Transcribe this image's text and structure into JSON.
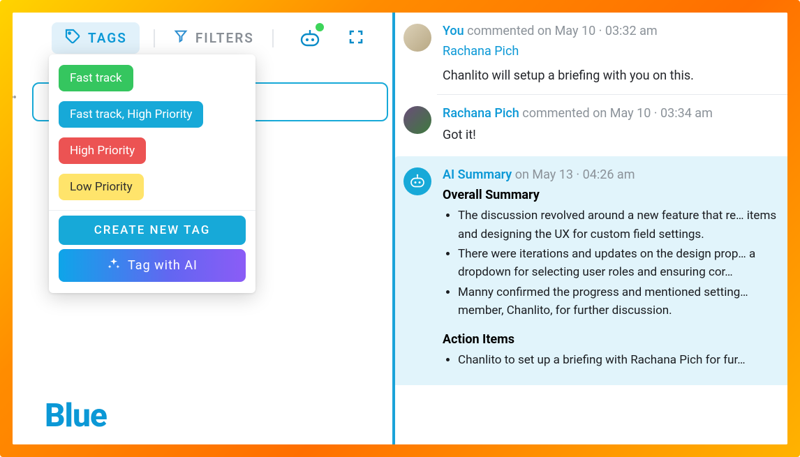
{
  "tabs": {
    "tags_label": "TAGS",
    "filters_label": "FILTERS"
  },
  "tags": {
    "items": [
      {
        "label": "Fast track",
        "color": "green"
      },
      {
        "label": "Fast track, High Priority",
        "color": "cyan"
      },
      {
        "label": "High Priority",
        "color": "red"
      },
      {
        "label": "Low Priority",
        "color": "yellow"
      }
    ],
    "create_label": "CREATE NEW TAG",
    "ai_tag_label": "Tag with AI"
  },
  "brand": "Blue",
  "comments": [
    {
      "author": "You",
      "action": "commented on",
      "date": "May 10",
      "time": "03:32 am",
      "mention": "Rachana Pich",
      "text": "Chanlito will setup a briefing with you on this."
    },
    {
      "author": "Rachana Pich",
      "action": "commented on",
      "date": "May 10",
      "time": "03:34 am",
      "text": "Got it!"
    }
  ],
  "ai_summary": {
    "title": "AI Summary",
    "meta_prefix": "on",
    "date": "May 13",
    "time": "04:26 am",
    "overall_heading": "Overall Summary",
    "overall_bullets": [
      "The discussion revolved around a new feature that re… items and designing the UX for custom field settings.",
      "There were iterations and updates on the design prop… a dropdown for selecting user roles and ensuring cor…",
      "Manny confirmed the progress and mentioned setting… member, Chanlito, for further discussion."
    ],
    "action_heading": "Action Items",
    "action_bullets": [
      "Chanlito to set up a briefing with Rachana Pich for fur…"
    ]
  }
}
